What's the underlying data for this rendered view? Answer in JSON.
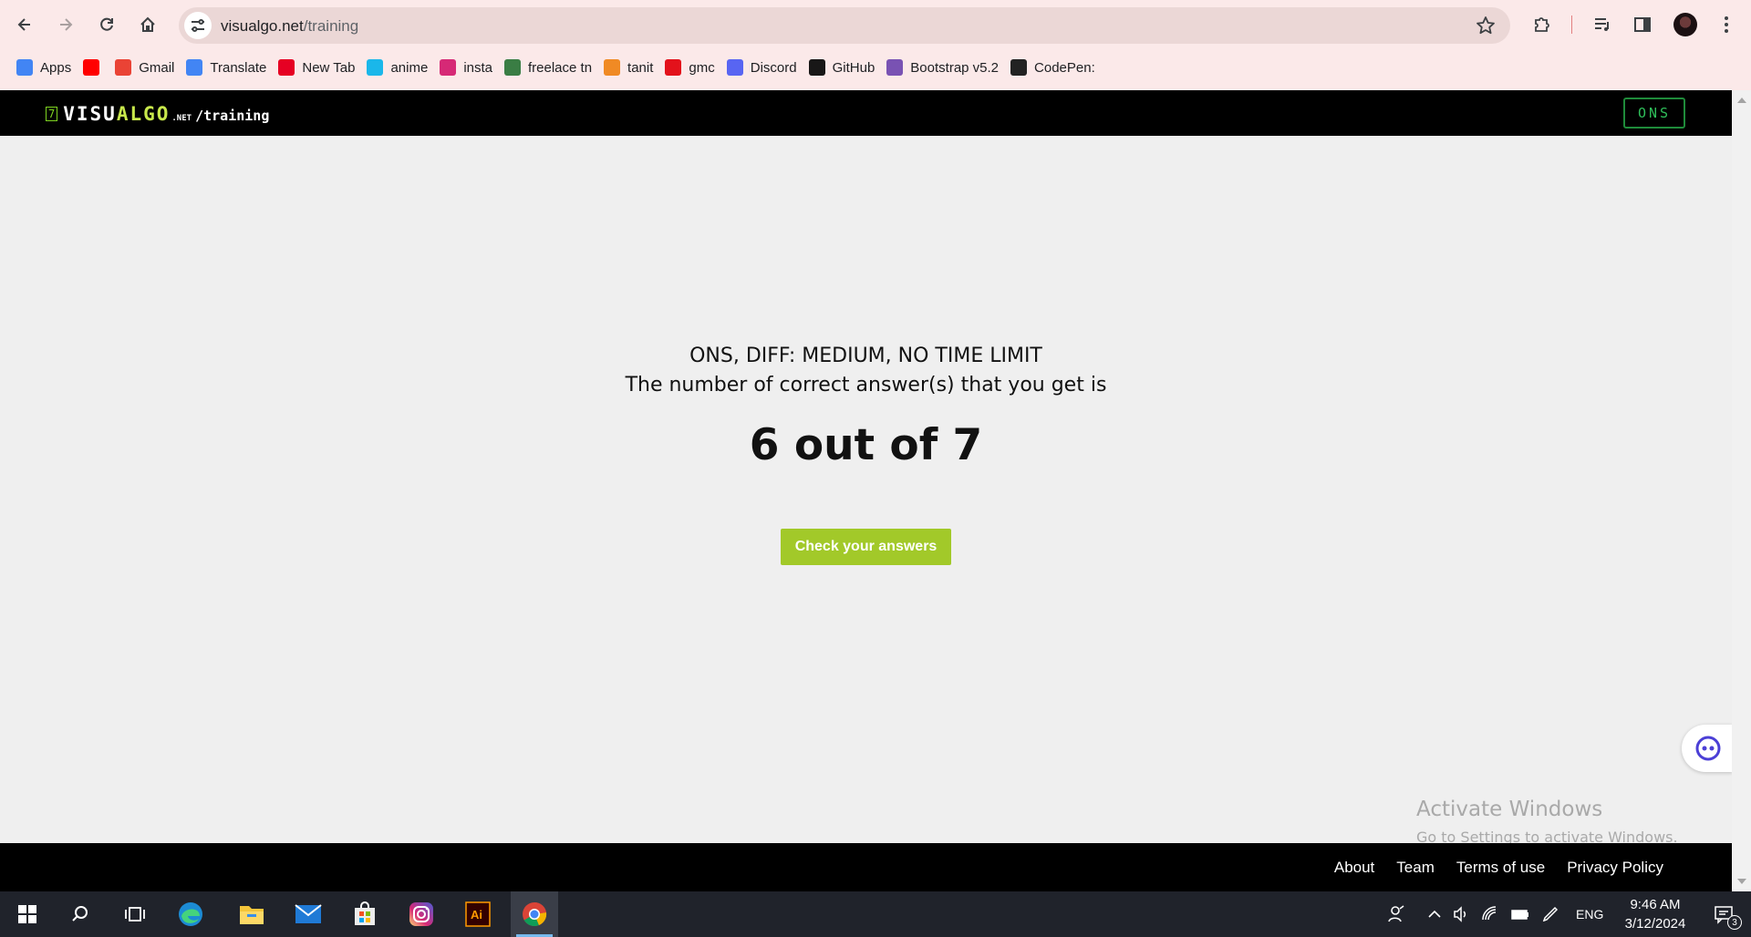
{
  "browser": {
    "url_domain": "visualgo.net",
    "url_path": "/training",
    "bookmarks": [
      {
        "label": "Apps",
        "icon": "apps-grid-icon",
        "color": "#4285f4"
      },
      {
        "label": "",
        "icon": "youtube-icon",
        "color": "#ff0000"
      },
      {
        "label": "Gmail",
        "icon": "gmail-icon",
        "color": "#ea4335"
      },
      {
        "label": "Translate",
        "icon": "translate-icon",
        "color": "#4285f4"
      },
      {
        "label": "New Tab",
        "icon": "pinterest-icon",
        "color": "#e60023"
      },
      {
        "label": "anime",
        "icon": "anime-icon",
        "color": "#1ab7ea"
      },
      {
        "label": "insta",
        "icon": "instagram-icon",
        "color": "#d62976"
      },
      {
        "label": "freelace tn",
        "icon": "freelance-icon",
        "color": "#3a7d44"
      },
      {
        "label": "tanit",
        "icon": "tanit-icon",
        "color": "#f08a24"
      },
      {
        "label": "gmc",
        "icon": "gmc-icon",
        "color": "#e3121b"
      },
      {
        "label": "Discord",
        "icon": "discord-icon",
        "color": "#5865f2"
      },
      {
        "label": "GitHub",
        "icon": "github-icon",
        "color": "#181717"
      },
      {
        "label": "Bootstrap v5.2",
        "icon": "bootstrap-icon",
        "color": "#7952b3"
      },
      {
        "label": "CodePen:",
        "icon": "codepen-icon",
        "color": "#222222"
      }
    ]
  },
  "header": {
    "logo_badge": "7",
    "logo_vis": "VISU",
    "logo_algo": "ALGO",
    "logo_net": ".NET",
    "logo_path": "/training",
    "user_label": "ONS"
  },
  "result": {
    "quiz_info": "ONS, DIFF: MEDIUM, NO TIME LIMIT",
    "prompt": "The number of correct answer(s) that you get is",
    "score_text": "6 out of 7",
    "correct": 6,
    "total": 7,
    "button_label": "Check your answers",
    "button_color": "#a2c929"
  },
  "watermark": {
    "title": "Activate Windows",
    "subtitle": "Go to Settings to activate Windows."
  },
  "footer": {
    "links": [
      "About",
      "Team",
      "Terms of use",
      "Privacy Policy"
    ]
  },
  "taskbar": {
    "language": "ENG",
    "time": "9:46 AM",
    "date": "3/12/2024",
    "notification_count": "3"
  }
}
